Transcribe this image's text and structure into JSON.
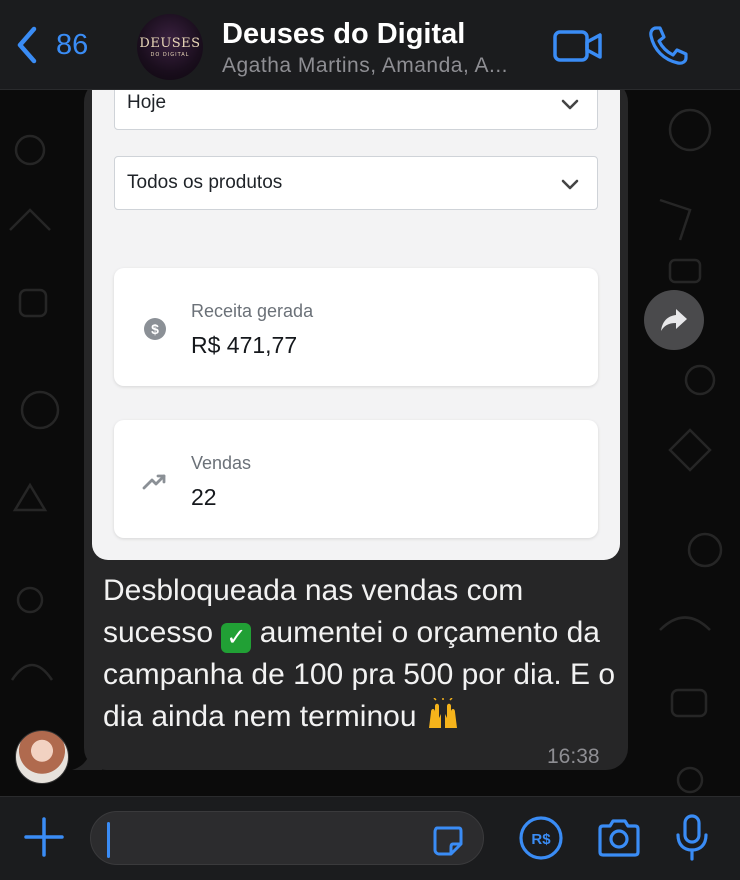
{
  "header": {
    "back_count": "86",
    "title": "Deuses do Digital",
    "subtitle": "Agatha Martins, Amanda, A...",
    "avatar_logo_top": "DEUSES",
    "avatar_logo_bottom": "DO DIGITAL"
  },
  "message": {
    "dashboard": {
      "period_select": "Hoje",
      "product_select": "Todos os produtos",
      "revenue_label": "Receita gerada",
      "revenue_value": "R$ 471,77",
      "sales_label": "Vendas",
      "sales_value": "22"
    },
    "text_part1": "Desbloqueada nas vendas com sucesso",
    "text_part2": "aumentei o orçamento da campanha de 100 pra 500 por dia. E o dia ainda nem terminou",
    "time": "16:38"
  },
  "icons": {
    "back": "chevron-left-icon",
    "video": "video-camera-icon",
    "call": "phone-icon",
    "forward": "forward-arrow-icon",
    "plus": "plus-icon",
    "sticker": "sticker-icon",
    "pay": "payment-icon",
    "camera": "camera-icon",
    "mic": "microphone-icon"
  },
  "colors": {
    "accent": "#3a8cf5",
    "bubble": "#262627",
    "header": "#1b1c1e"
  }
}
